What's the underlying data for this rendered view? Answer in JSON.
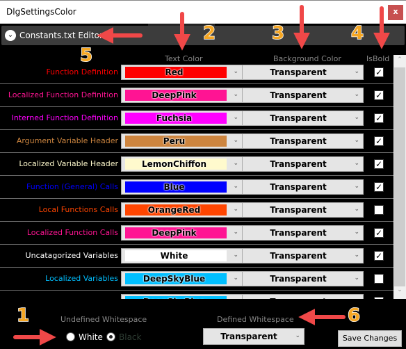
{
  "window": {
    "title": "DlgSettingsColor",
    "close": "x"
  },
  "expander": {
    "label": "Constants.txt Editor",
    "icon": "chevron-down-circle-icon"
  },
  "headers": {
    "text_color": "Text Color",
    "background_color": "Background Color",
    "is_bold": "IsBold"
  },
  "rows": [
    {
      "label": "Function Definition",
      "text_color": "Red",
      "swatch": "#ff0000",
      "background": "Transparent",
      "bold": true
    },
    {
      "label": "Localized Function Definition",
      "text_color": "DeepPink",
      "swatch": "#ff1493",
      "background": "Transparent",
      "bold": true
    },
    {
      "label": "Interned Function Definition",
      "text_color": "Fuchsia",
      "swatch": "#ff00ff",
      "background": "Transparent",
      "bold": true
    },
    {
      "label": "Argument Variable Header",
      "text_color": "Peru",
      "swatch": "#cd853f",
      "background": "Transparent",
      "bold": true
    },
    {
      "label": "Localized Variable Header",
      "text_color": "LemonChiffon",
      "swatch": "#fffacd",
      "background": "Transparent",
      "bold": true
    },
    {
      "label": "Function (General) Calls",
      "text_color": "Blue",
      "swatch": "#0000ff",
      "background": "Transparent",
      "bold": true
    },
    {
      "label": "Local Functions Calls",
      "text_color": "OrangeRed",
      "swatch": "#ff4500",
      "background": "Transparent",
      "bold": false
    },
    {
      "label": "Localized Function Calls",
      "text_color": "DeepPink",
      "swatch": "#ff1493",
      "background": "Transparent",
      "bold": true
    },
    {
      "label": "Uncatagorized Variables",
      "text_color": "White",
      "swatch": "#ffffff",
      "background": "Transparent",
      "bold": true
    },
    {
      "label": "Localized Variables",
      "text_color": "DeepSkyBlue",
      "swatch": "#00bfff",
      "background": "Transparent",
      "bold": false
    },
    {
      "label": "",
      "text_color": "DeepSkyBlue",
      "swatch": "#00bfff",
      "background": "Transparent",
      "bold": true
    }
  ],
  "bottom": {
    "undefined_ws_label": "Undefined Whitespace",
    "white": "White",
    "black": "Black",
    "selected": "Black",
    "defined_ws_label": "Defined Whitespace",
    "defined_ws_value": "Transparent",
    "save": "Save Changes"
  },
  "annotations": {
    "color": "#f04848",
    "number_color": "#f5a623",
    "numbers": [
      "1",
      "2",
      "3",
      "4",
      "5",
      "6"
    ]
  }
}
